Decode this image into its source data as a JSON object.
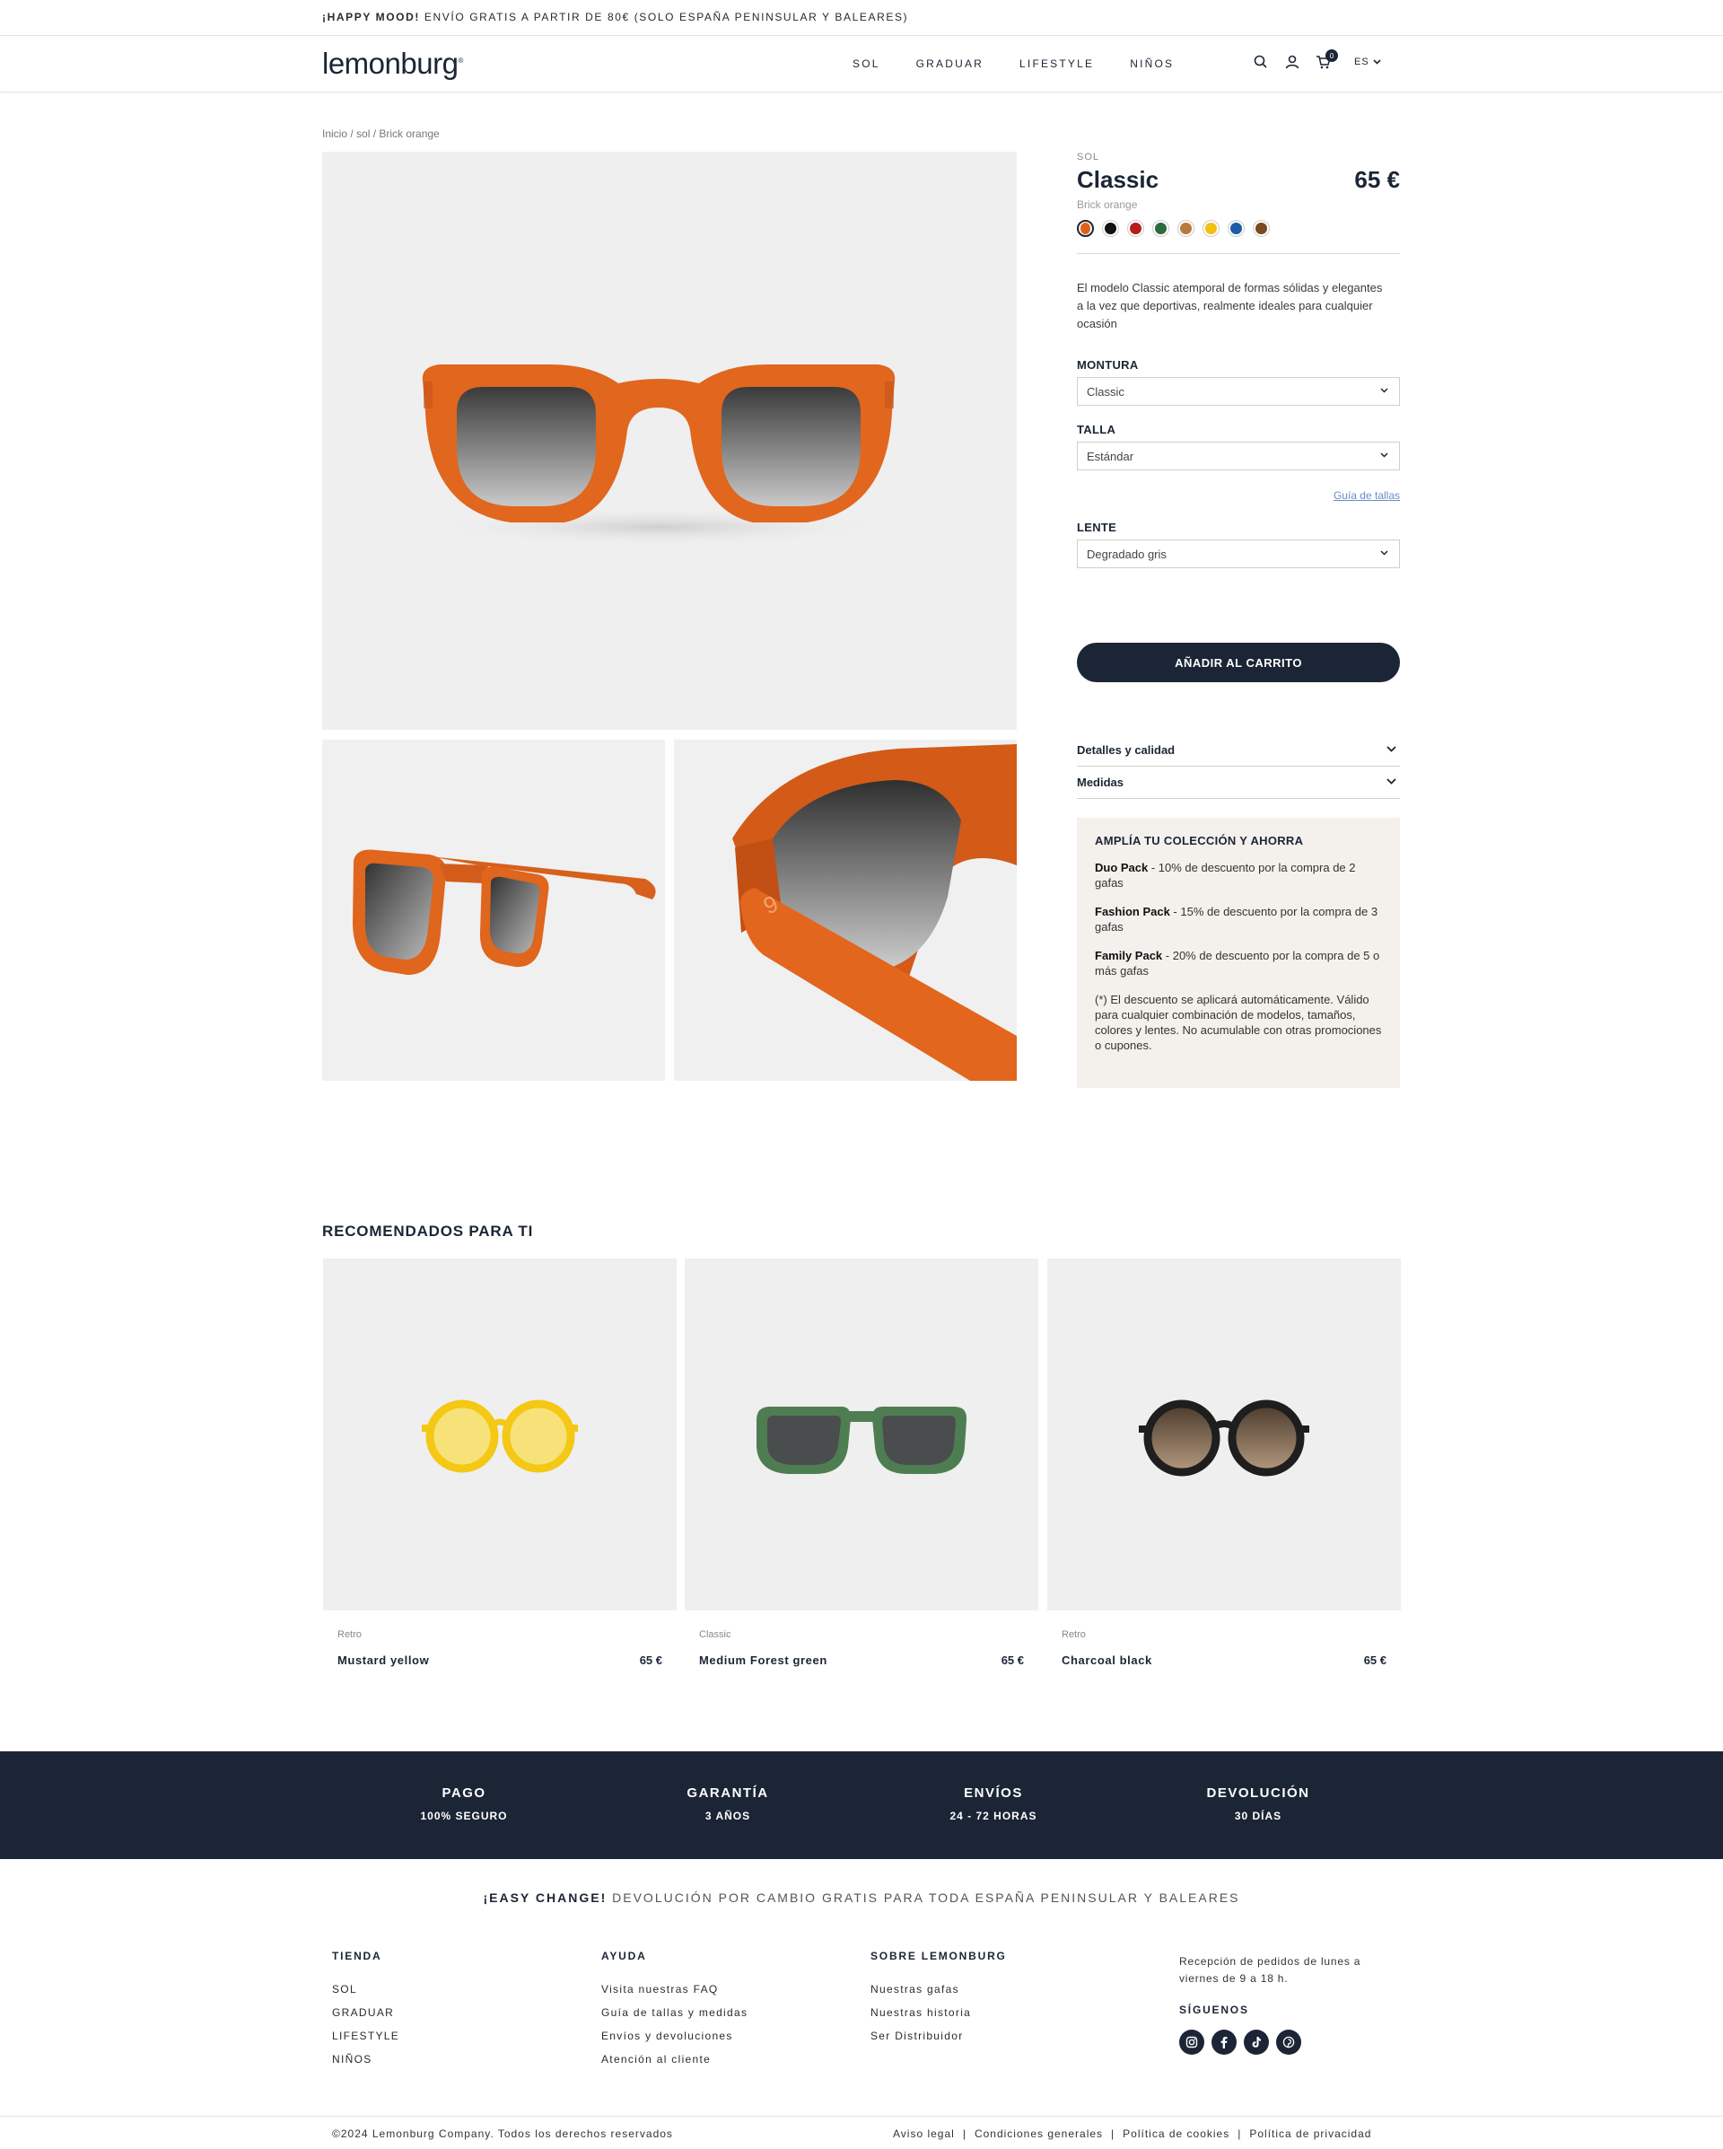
{
  "promo": {
    "bold": "¡HAPPY MOOD!",
    "text": " ENVÍO GRATIS A PARTIR DE 80€ (SOLO ESPAÑA PENINSULAR Y BALEARES)"
  },
  "header": {
    "logo": "lemonburg",
    "nav": [
      "SOL",
      "GRADUAR",
      "LIFESTYLE",
      "NIÑOS"
    ],
    "cart_count": "0",
    "lang": "ES"
  },
  "breadcrumb": "Inicio / sol / Brick orange",
  "product": {
    "category": "SOL",
    "name": "Classic",
    "price": "65 €",
    "color_name": "Brick orange",
    "swatches": [
      {
        "name": "brick-orange",
        "color": "#e0621a",
        "active": true
      },
      {
        "name": "black",
        "color": "#111111"
      },
      {
        "name": "red",
        "color": "#b71c1c"
      },
      {
        "name": "forest-green",
        "color": "#2e6b3c"
      },
      {
        "name": "tortoise-clear",
        "color": "#b97a3e"
      },
      {
        "name": "mustard-yellow",
        "color": "#f2c110"
      },
      {
        "name": "blue",
        "color": "#1f5ba8"
      },
      {
        "name": "tortoise",
        "color": "#7a4a22"
      }
    ],
    "description": "El modelo Classic atemporal de formas sólidas y elegantes a la vez que deportivas, realmente ideales para cualquier ocasión",
    "montura_label": "MONTURA",
    "montura_value": "Classic",
    "talla_label": "TALLA",
    "talla_value": "Estándar",
    "guide_link": "Guía de tallas",
    "lente_label": "LENTE",
    "lente_value": "Degradado gris",
    "add_button": "AÑADIR AL CARRITO",
    "accordion": [
      "Detalles y calidad",
      "Medidas"
    ],
    "promo_box": {
      "title": "AMPLÍA TU COLECCIÓN Y AHORRA",
      "items": [
        {
          "bold": "Duo Pack",
          "text": " - 10% de descuento por la compra de 2 gafas"
        },
        {
          "bold": "Fashion Pack",
          "text": " - 15% de descuento por la compra de 3 gafas"
        },
        {
          "bold": "Family Pack",
          "text": " - 20% de descuento por la compra de 5 o más gafas"
        }
      ],
      "note": "(*) El descuento se aplicará automáticamente. Válido para cualquier combinación de modelos, tamaños, colores y lentes. No acumulable con otras promociones o cupones."
    }
  },
  "recommended": {
    "title": "RECOMENDADOS PARA TI",
    "items": [
      {
        "category": "Retro",
        "name": "Mustard yellow",
        "price": "65 €",
        "frame_color": "#f4c814"
      },
      {
        "category": "Classic",
        "name": "Medium Forest green",
        "price": "65 €",
        "frame_color": "#4f7d52"
      },
      {
        "category": "Retro",
        "name": "Charcoal black",
        "price": "65 €",
        "frame_color": "#1e1e1e"
      }
    ]
  },
  "guarantees": [
    {
      "title": "PAGO",
      "sub": "100% SEGURO"
    },
    {
      "title": "GARANTÍA",
      "sub": "3 AÑOS"
    },
    {
      "title": "ENVÍOS",
      "sub": "24 - 72 HORAS"
    },
    {
      "title": "DEVOLUCIÓN",
      "sub": "30 DÍAS"
    }
  ],
  "easy_change": {
    "bold": "¡EASY CHANGE!",
    "text": " DEVOLUCIÓN POR CAMBIO GRATIS PARA TODA ESPAÑA PENINSULAR Y BALEARES"
  },
  "footer": {
    "tienda": {
      "title": "TIENDA",
      "links": [
        "SOL",
        "GRADUAR",
        "LIFESTYLE",
        "NIÑOS"
      ]
    },
    "ayuda": {
      "title": "AYUDA",
      "links": [
        "Visita nuestras FAQ",
        "Guía de tallas y medidas",
        "Envíos y devoluciones",
        "Atención al cliente"
      ]
    },
    "sobre": {
      "title": "SOBRE LEMONBURG",
      "links": [
        "Nuestras gafas",
        "Nuestras historia",
        "Ser Distribuidor"
      ]
    },
    "reception": "Recepción de pedidos de lunes a viernes de 9 a 18 h.",
    "follow": "SÍGUENOS",
    "socials": [
      "instagram-icon",
      "facebook-icon",
      "tiktok-icon",
      "pinterest-icon"
    ],
    "copyright": "©2024 Lemonburg Company. Todos los derechos reservados",
    "legal": [
      "Aviso legal",
      "Condiciones generales",
      "Política de cookies",
      "Política de privacidad"
    ]
  },
  "colors": {
    "navy": "#1b2535",
    "accent_link": "#6b8cc9",
    "promo_bg": "#f4f1ed"
  }
}
